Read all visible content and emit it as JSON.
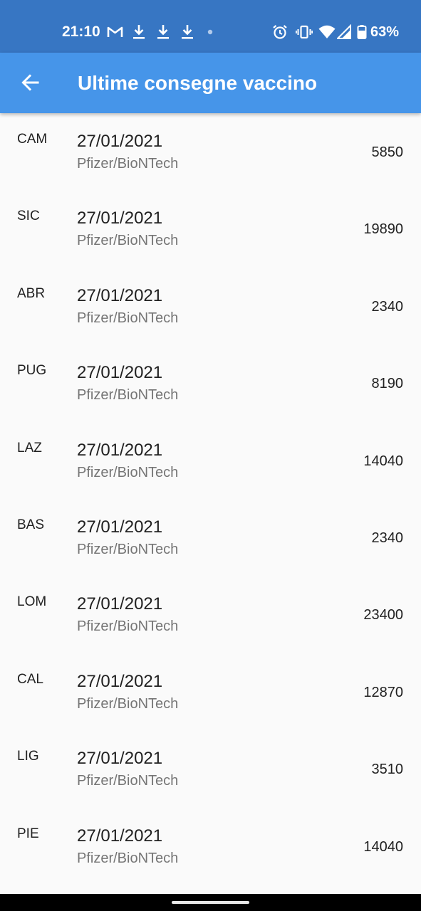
{
  "status_bar": {
    "time": "21:10",
    "battery_text": "63%",
    "icons": [
      "gmail-icon",
      "download-icon",
      "download-icon",
      "download-icon",
      "notification-dot-icon",
      "alarm-icon",
      "vibrate-icon",
      "wifi-icon",
      "signal-icon",
      "battery-icon"
    ]
  },
  "appbar": {
    "title": "Ultime consegne vaccino",
    "back_icon": "arrow-left-icon"
  },
  "colors": {
    "status_bar": "#3776c3",
    "app_bar": "#4695e9",
    "background": "#fafafa",
    "primary_text": "#212121",
    "secondary_text": "#757575"
  },
  "deliveries": [
    {
      "region": "CAM",
      "date": "27/01/2021",
      "supplier": "Pfizer/BioNTech",
      "quantity": "5850"
    },
    {
      "region": "SIC",
      "date": "27/01/2021",
      "supplier": "Pfizer/BioNTech",
      "quantity": "19890"
    },
    {
      "region": "ABR",
      "date": "27/01/2021",
      "supplier": "Pfizer/BioNTech",
      "quantity": "2340"
    },
    {
      "region": "PUG",
      "date": "27/01/2021",
      "supplier": "Pfizer/BioNTech",
      "quantity": "8190"
    },
    {
      "region": "LAZ",
      "date": "27/01/2021",
      "supplier": "Pfizer/BioNTech",
      "quantity": "14040"
    },
    {
      "region": "BAS",
      "date": "27/01/2021",
      "supplier": "Pfizer/BioNTech",
      "quantity": "2340"
    },
    {
      "region": "LOM",
      "date": "27/01/2021",
      "supplier": "Pfizer/BioNTech",
      "quantity": "23400"
    },
    {
      "region": "CAL",
      "date": "27/01/2021",
      "supplier": "Pfizer/BioNTech",
      "quantity": "12870"
    },
    {
      "region": "LIG",
      "date": "27/01/2021",
      "supplier": "Pfizer/BioNTech",
      "quantity": "3510"
    },
    {
      "region": "PIE",
      "date": "27/01/2021",
      "supplier": "Pfizer/BioNTech",
      "quantity": "14040"
    }
  ]
}
